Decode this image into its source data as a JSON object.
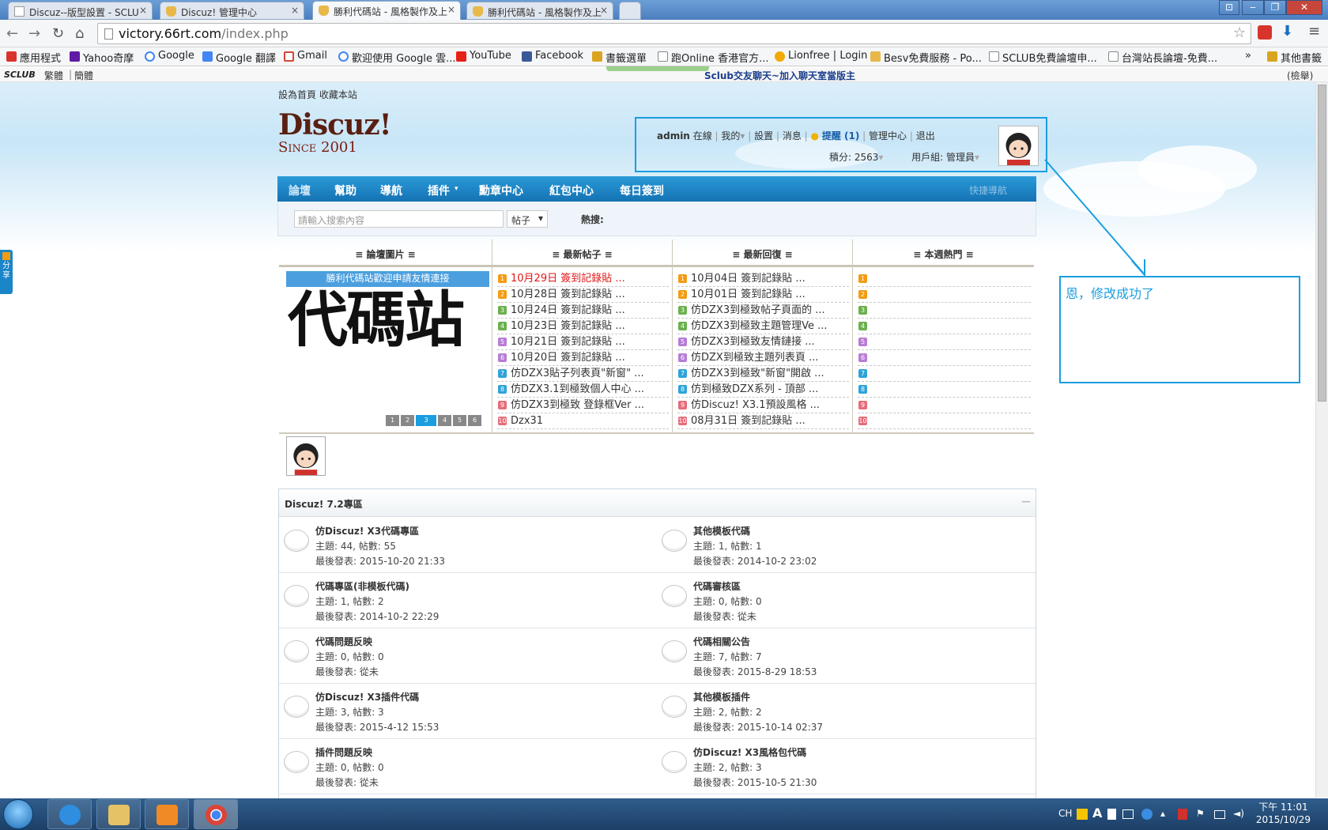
{
  "browser": {
    "tabs": [
      {
        "label": "Discuz--版型設置 - SCLU",
        "close": "×"
      },
      {
        "label": "Discuz! 管理中心",
        "close": "×"
      },
      {
        "label": "勝利代碼站 - 風格製作及上",
        "close": "×"
      },
      {
        "label": "勝利代碼站 - 風格製作及上",
        "close": "×"
      }
    ],
    "window_buttons": {
      "extra": "⊡",
      "minimize": "‒",
      "restore": "❐",
      "close": "✕"
    },
    "url_host": "victory.66rt.com",
    "url_path": "/index.php",
    "bookmarks": [
      {
        "label": "應用程式",
        "color": "#d9342b"
      },
      {
        "label": "Yahoo奇摩",
        "color": "#5f1ba6"
      },
      {
        "label": "Google",
        "color": "#4285f4"
      },
      {
        "label": "Google 翻譯",
        "color": "#4285f4"
      },
      {
        "label": "Gmail",
        "color": "#d44638"
      },
      {
        "label": "歡迎使用 Google 雲...",
        "color": "#4285f4"
      },
      {
        "label": "YouTube",
        "color": "#e62117"
      },
      {
        "label": "Facebook",
        "color": "#3b5998"
      },
      {
        "label": "書籤選單",
        "color": "#d9a520"
      },
      {
        "label": "跑Online 香港官方...",
        "color": "#ffffff"
      },
      {
        "label": "Lionfree | Login",
        "color": "#f2a900"
      },
      {
        "label": "Besv免費服務 - Po...",
        "color": "#e8b84a"
      },
      {
        "label": "SCLUB免費論壇申...",
        "color": "#ffffff"
      },
      {
        "label": "台灣站長論壇-免費...",
        "color": "#ffffff"
      }
    ],
    "bookmarks_more": "»",
    "other_bookmarks": "其他書籤"
  },
  "sclub_bar": {
    "brand": "SCLUB",
    "trad": "繁體",
    "simp": "簡體",
    "chat": "Sclub交友聊天~加入聊天室當版主",
    "report": "(檢舉)"
  },
  "site": {
    "toplinks": [
      "設為首頁",
      "收藏本站"
    ],
    "logo_main": "Discuz!",
    "logo_sub": "Since 2001",
    "user": {
      "name": "admin",
      "status": "在線",
      "mine": "我的",
      "settings": "設置",
      "messages": "消息",
      "reminder": "提醒 (1)",
      "admin_center": "管理中心",
      "logout": "退出",
      "points": "積分: 2563",
      "group": "用戶組: 管理員"
    },
    "nav": [
      "論壇",
      "幫助",
      "導航",
      "插件",
      "勳章中心",
      "紅包中心",
      "每日簽到"
    ],
    "quick_nav": "快捷導航",
    "search": {
      "placeholder": "請輸入搜索內容",
      "type": "帖子",
      "hot": "熱搜:"
    }
  },
  "portal": {
    "columns": [
      "≡ 論壇圖片 ≡",
      "≡ 最新帖子 ≡",
      "≡ 最新回復 ≡",
      "≡ 本週熱門 ≡"
    ],
    "slide_caption": "勝利代碼站歡迎申請友情連接",
    "slide_text": "代碼站",
    "slide_dots": [
      "1",
      "2",
      "3",
      "4",
      "5",
      "6"
    ],
    "slide_active": 3,
    "latest_posts": [
      "10月29日 簽到記錄貼 ...",
      "10月28日 簽到記錄貼 ...",
      "10月24日 簽到記錄貼 ...",
      "10月23日 簽到記錄貼 ...",
      "10月21日 簽到記錄貼 ...",
      "10月20日 簽到記錄貼 ...",
      "仿DZX3貼子列表頁\"新窗\" ...",
      "仿DZX3.1到極致個人中心 ...",
      "仿DZX3到極致 登錄框Ver ...",
      "Dzx31"
    ],
    "latest_replies": [
      "10月04日 簽到記錄貼 ...",
      "10月01日 簽到記錄貼 ...",
      "仿DZX3到極致帖子頁面的 ...",
      "仿DZX3到極致主題管理Ve ...",
      "仿DZX3到極致友情鏈接 ...",
      "仿DZX到極致主題列表頁 ...",
      "仿DZX3到極致\"新窗\"開啟 ...",
      "仿到極致DZX系列 - 頂部 ...",
      "仿Discuz! X3.1預設風格 ...",
      "08月31日 簽到記錄貼 ..."
    ],
    "rank_numbers": [
      "1",
      "2",
      "3",
      "4",
      "5",
      "6",
      "7",
      "8",
      "9",
      "10"
    ],
    "rank_colors": [
      "#f39c12",
      "#f39c12",
      "#6ab04c",
      "#6ab04c",
      "#b77dd6",
      "#b77dd6",
      "#2fa3d8",
      "#2fa3d8",
      "#e46d7a",
      "#e46d7a"
    ]
  },
  "forum": {
    "section_title": "Discuz! 7.2專區",
    "collapse": "—",
    "boards": [
      {
        "title": "仿Discuz! X3代碼專區",
        "stats": "主題: 44, 帖數: 55",
        "last": "最後發表: 2015-10-20 21:33"
      },
      {
        "title": "其他模板代碼",
        "stats": "主題: 1, 帖數: 1",
        "last": "最後發表: 2014-10-2 23:02"
      },
      {
        "title": "代碼專區(非模板代碼)",
        "stats": "主題: 1, 帖數: 2",
        "last": "最後發表: 2014-10-2 22:29"
      },
      {
        "title": "代碼審核區",
        "stats": "主題: 0, 帖數: 0",
        "last": "最後發表: 從未"
      },
      {
        "title": "代碼問題反映",
        "stats": "主題: 0, 帖數: 0",
        "last": "最後發表: 從未"
      },
      {
        "title": "代碼相關公告",
        "stats": "主題: 7, 帖數: 7",
        "last": "最後發表: 2015-8-29 18:53"
      },
      {
        "title": "仿Discuz! X3插件代碼",
        "stats": "主題: 3, 帖數: 3",
        "last": "最後發表: 2015-4-12 15:53"
      },
      {
        "title": "其他模板插件",
        "stats": "主題: 2, 帖數: 2",
        "last": "最後發表: 2015-10-14 02:37"
      },
      {
        "title": "插件問題反映",
        "stats": "主題: 0, 帖數: 0",
        "last": "最後發表: 從未"
      },
      {
        "title": "仿Discuz! X3風格包代碼",
        "stats": "主題: 2, 帖數: 3",
        "last": "最後發表: 2015-10-5 21:30"
      }
    ]
  },
  "annotation": {
    "note": "恩，修改成功了"
  },
  "share_tab": "分享",
  "taskbar": {
    "ime": "CH",
    "time": "下午 11:01",
    "date": "2015/10/29"
  },
  "colors": {
    "accent": "#1a9ee0",
    "nav": "#1a85c8",
    "logo": "#5a1f12",
    "hot_link": "#e01818"
  }
}
